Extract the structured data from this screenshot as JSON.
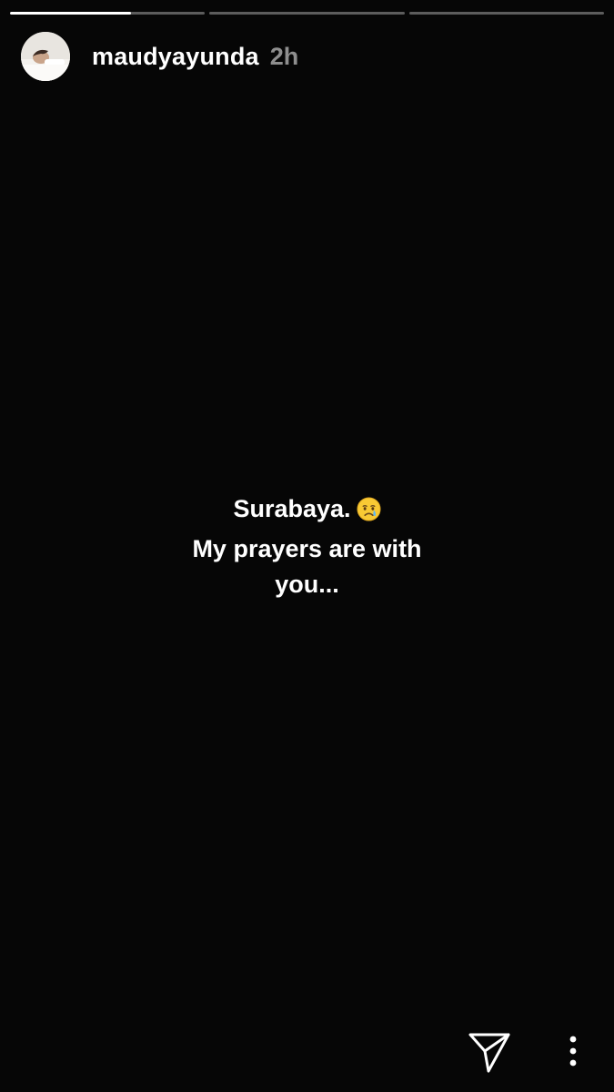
{
  "story": {
    "progress": [
      0.62,
      0,
      0
    ],
    "user": {
      "username": "maudyayunda",
      "time_ago": "2h"
    },
    "caption": {
      "line1": "Surabaya.",
      "emoji": "crying-face-icon",
      "line2": "My prayers are with",
      "line3": "you..."
    },
    "actions": {
      "send_icon": "paper-plane-icon",
      "more_icon": "vertical-ellipsis-icon"
    }
  }
}
